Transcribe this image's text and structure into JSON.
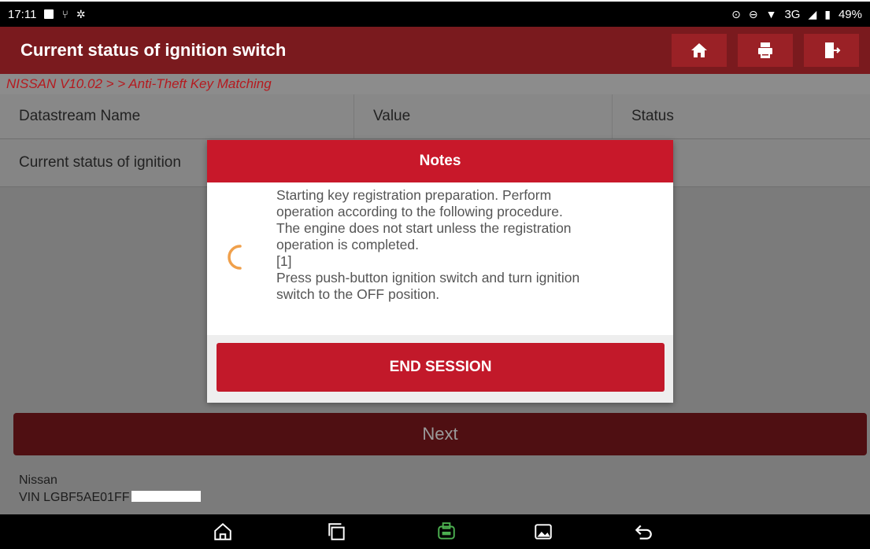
{
  "status_bar": {
    "time": "17:11",
    "network": "3G",
    "battery": "49%"
  },
  "titlebar": {
    "title": "Current status of ignition switch",
    "home_icon": "home-icon",
    "print_icon": "printer-icon",
    "exit_icon": "exit-icon"
  },
  "breadcrumb": "NISSAN V10.02 > > Anti-Theft Key Matching",
  "table": {
    "columns": [
      "Datastream Name",
      "Value",
      "Status"
    ],
    "rows": [
      {
        "name": "Current status of ignition",
        "value": "",
        "status": ""
      }
    ]
  },
  "next_label": "Next",
  "vehicle": {
    "make": "Nissan",
    "vin": "VIN LGBF5AE01FF"
  },
  "dialog": {
    "title": "Notes",
    "message": "Starting key registration preparation. Perform\noperation according to the following procedure.\nThe engine does not start unless the registration\noperation is completed.\n[1]\nPress push-button ignition switch and turn ignition\nswitch to the OFF position.",
    "button": "END SESSION"
  },
  "colors": {
    "title_bar": "#7a1a1e",
    "dialog_header": "#c8182a",
    "end_button": "#c2192a",
    "breadcrumb_text": "#b51a1f",
    "spinner": "#f0a04b",
    "vci_icon": "#4caf50"
  }
}
